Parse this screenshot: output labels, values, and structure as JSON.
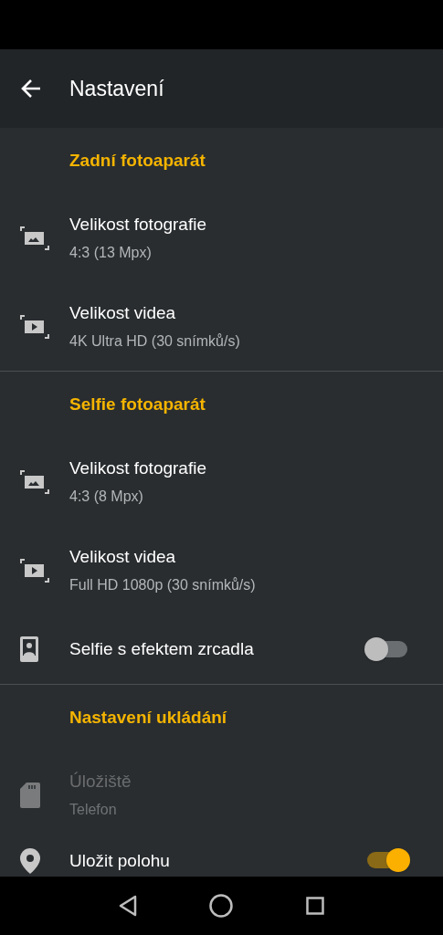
{
  "app_bar": {
    "title": "Nastavení"
  },
  "sections": [
    {
      "header": "Zadní fotoaparát",
      "items": [
        {
          "kind": "photo",
          "title": "Velikost fotografie",
          "subtitle": "4:3 (13 Mpx)",
          "disabled": false
        },
        {
          "kind": "video",
          "title": "Velikost videa",
          "subtitle": "4K Ultra HD (30 snímků/s)",
          "disabled": false
        }
      ]
    },
    {
      "header": "Selfie fotoaparát",
      "items": [
        {
          "kind": "photo",
          "title": "Velikost fotografie",
          "subtitle": "4:3 (8 Mpx)",
          "disabled": false
        },
        {
          "kind": "video",
          "title": "Velikost videa",
          "subtitle": "Full HD 1080p (30 snímků/s)",
          "disabled": false
        },
        {
          "kind": "portrait",
          "title": "Selfie s efektem zrcadla",
          "on": false,
          "disabled": false
        }
      ]
    },
    {
      "header": "Nastavení ukládání",
      "items": [
        {
          "kind": "sdcard",
          "title": "Úložiště",
          "subtitle": "Telefon",
          "disabled": true
        },
        {
          "kind": "location",
          "title": "Uložit polohu",
          "on": true,
          "disabled": false
        }
      ]
    }
  ]
}
